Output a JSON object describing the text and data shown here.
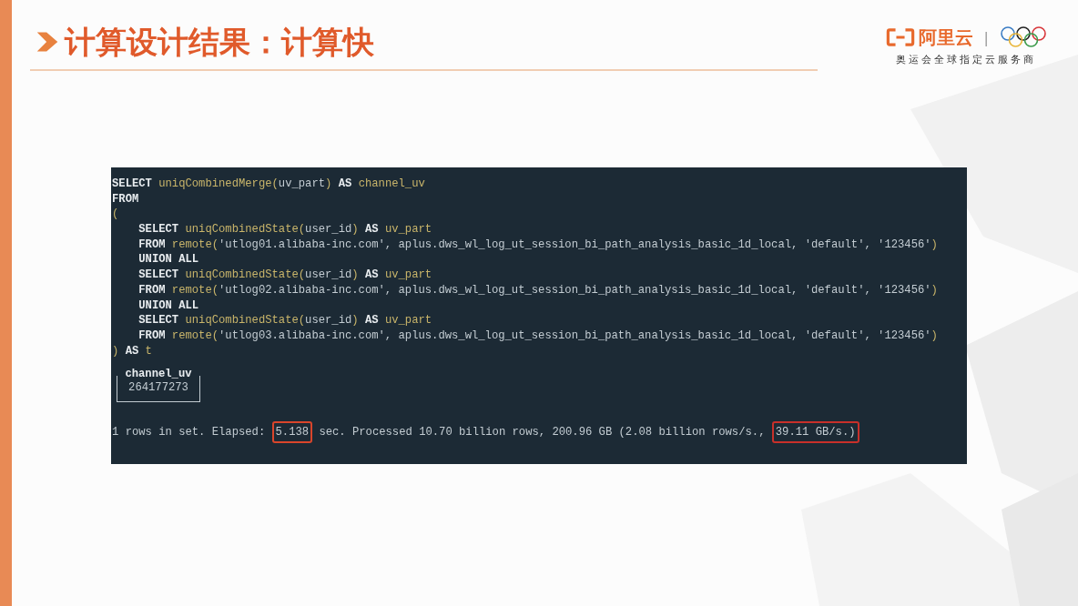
{
  "slide": {
    "title": "计算设计结果：计算快",
    "logo": {
      "brand": "阿里云",
      "separator": "|",
      "tagline": "奥运会全球指定云服务商"
    }
  },
  "terminal": {
    "code_lines": [
      {
        "indented": false,
        "tokens": [
          {
            "kind": "keyword",
            "text": "SELECT "
          },
          {
            "kind": "func",
            "text": "uniqCombinedMerge("
          },
          {
            "kind": "plain",
            "text": "uv_part"
          },
          {
            "kind": "func",
            "text": ") "
          },
          {
            "kind": "keyword",
            "text": "AS "
          },
          {
            "kind": "func",
            "text": "channel_uv"
          }
        ]
      },
      {
        "indented": false,
        "tokens": [
          {
            "kind": "keyword",
            "text": "FROM"
          }
        ]
      },
      {
        "indented": false,
        "tokens": [
          {
            "kind": "func",
            "text": "("
          }
        ]
      },
      {
        "indented": true,
        "tokens": [
          {
            "kind": "keyword",
            "text": "SELECT "
          },
          {
            "kind": "func",
            "text": "uniqCombinedState("
          },
          {
            "kind": "plain",
            "text": "user_id"
          },
          {
            "kind": "func",
            "text": ") "
          },
          {
            "kind": "keyword",
            "text": "AS "
          },
          {
            "kind": "func",
            "text": "uv_part"
          }
        ]
      },
      {
        "indented": true,
        "tokens": [
          {
            "kind": "keyword",
            "text": "FROM "
          },
          {
            "kind": "func",
            "text": "remote("
          },
          {
            "kind": "plain",
            "text": "'utlog01.alibaba-inc.com', aplus.dws_wl_log_ut_session_bi_path_analysis_basic_1d_local, 'default', '123456'"
          },
          {
            "kind": "func",
            "text": ")"
          }
        ]
      },
      {
        "indented": true,
        "tokens": [
          {
            "kind": "keyword",
            "text": "UNION ALL"
          }
        ]
      },
      {
        "indented": true,
        "tokens": [
          {
            "kind": "keyword",
            "text": "SELECT "
          },
          {
            "kind": "func",
            "text": "uniqCombinedState("
          },
          {
            "kind": "plain",
            "text": "user_id"
          },
          {
            "kind": "func",
            "text": ") "
          },
          {
            "kind": "keyword",
            "text": "AS "
          },
          {
            "kind": "func",
            "text": "uv_part"
          }
        ]
      },
      {
        "indented": true,
        "tokens": [
          {
            "kind": "keyword",
            "text": "FROM "
          },
          {
            "kind": "func",
            "text": "remote("
          },
          {
            "kind": "plain",
            "text": "'utlog02.alibaba-inc.com', aplus.dws_wl_log_ut_session_bi_path_analysis_basic_1d_local, 'default', '123456'"
          },
          {
            "kind": "func",
            "text": ")"
          }
        ]
      },
      {
        "indented": true,
        "tokens": [
          {
            "kind": "keyword",
            "text": "UNION ALL"
          }
        ]
      },
      {
        "indented": true,
        "tokens": [
          {
            "kind": "keyword",
            "text": "SELECT "
          },
          {
            "kind": "func",
            "text": "uniqCombinedState("
          },
          {
            "kind": "plain",
            "text": "user_id"
          },
          {
            "kind": "func",
            "text": ") "
          },
          {
            "kind": "keyword",
            "text": "AS "
          },
          {
            "kind": "func",
            "text": "uv_part"
          }
        ]
      },
      {
        "indented": true,
        "tokens": [
          {
            "kind": "keyword",
            "text": "FROM "
          },
          {
            "kind": "func",
            "text": "remote("
          },
          {
            "kind": "plain",
            "text": "'utlog03.alibaba-inc.com', aplus.dws_wl_log_ut_session_bi_path_analysis_basic_1d_local, 'default', '123456'"
          },
          {
            "kind": "func",
            "text": ")"
          }
        ]
      },
      {
        "indented": false,
        "tokens": [
          {
            "kind": "func",
            "text": ") "
          },
          {
            "kind": "keyword",
            "text": "AS "
          },
          {
            "kind": "func",
            "text": "t"
          }
        ]
      }
    ],
    "result": {
      "column": "channel_uv",
      "value": "264177273"
    },
    "status": [
      {
        "text": "1 rows in set. Elapsed: ",
        "highlighted": false
      },
      {
        "text": "5.138",
        "highlighted": true,
        "color": "#d9452b"
      },
      {
        "text": " sec. Processed 10.70 billion rows, 200.96 GB (2.08 billion rows/s., ",
        "highlighted": false
      },
      {
        "text": "39.11 GB/s.)",
        "highlighted": true,
        "color": "#c8302a"
      }
    ]
  }
}
